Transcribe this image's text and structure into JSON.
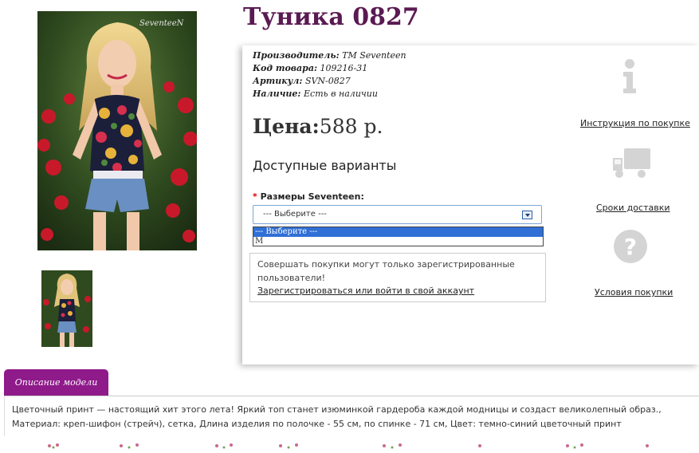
{
  "product": {
    "title": "Туника 0827",
    "specs": [
      {
        "label": "Производитель:",
        "value": "TM Seventeen"
      },
      {
        "label": "Код товара:",
        "value": "109216-31"
      },
      {
        "label": "Артикул:",
        "value": "SVN-0827"
      },
      {
        "label": "Наличие:",
        "value": "Есть в наличии"
      }
    ],
    "price_label": "Цена:",
    "price_value": "588 р.",
    "variants_title": "Доступные варианты",
    "size_label": "Размеры Seventeen:",
    "required_mark": "*",
    "size_select": {
      "selected": "--- Выберите ---",
      "options": [
        "--- Выберите ---",
        "M"
      ]
    },
    "photo_watermark": "SeventeeN"
  },
  "notice": {
    "text": "Совершать покупки могут только зарегистрированные пользователи!",
    "link": "Зарегистрироваться или войти в свой аккаунт"
  },
  "side_links": {
    "instruction": "Инструкция по покупке",
    "delivery": "Сроки доставки",
    "terms": "Условия покупки"
  },
  "description": {
    "tab_label": "Описание модели",
    "text": "Цветочный принт — настоящий хит этого лета! Яркий топ станет изюминкой гардероба каждой модницы и создаст великолепный образ., Материал: креп-шифон (стрейч), сетка, Длина изделия по полочке - 55 см, по спинке - 71 см, Цвет: темно-синий цветочный принт"
  },
  "icons": {
    "info": "info-icon",
    "delivery": "truck-icon",
    "help": "question-icon"
  },
  "colors": {
    "title": "#5a1a52",
    "tab": "#8f1a8a",
    "select_highlight": "#2f6fd6"
  }
}
